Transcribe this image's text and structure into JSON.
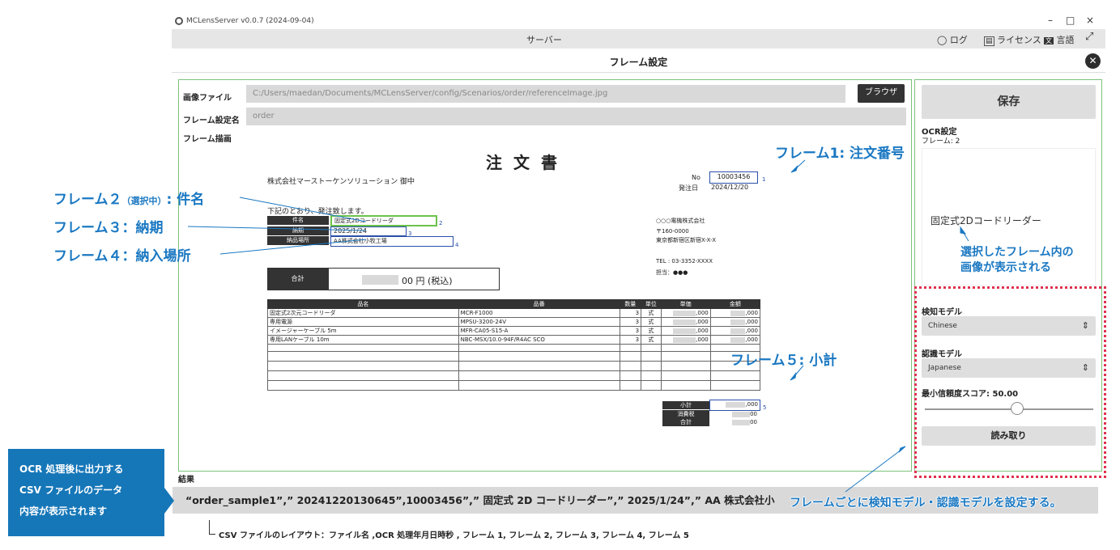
{
  "window": {
    "title": "MCLensServer v0.0.7 (2024-09-04)",
    "minimize": "–",
    "maximize": "□",
    "close": "×"
  },
  "topbar": {
    "title": "サーバー",
    "log_label": "ログ",
    "license_label": "ライセンス",
    "language_label": "言語"
  },
  "dialog": {
    "title": "フレーム設定"
  },
  "form": {
    "image_file_label": "画像ファイル",
    "image_file_value": "C:/Users/maedan/Documents/MCLensServer/config/Scenarios/order/referenceImage.jpg",
    "browse_label": "ブラウザ",
    "frame_name_label": "フレーム設定名",
    "frame_name_value": "order",
    "frame_draw_label": "フレーム描画",
    "result_label": "結果",
    "result_value": "“order_sample1”,” 20241220130645”,10003456”,” 固定式 2D コードリーダー”,” 2025/1/24”,” AA 株式会社小"
  },
  "document": {
    "title": "注文書",
    "addressee": "株式会社マーストーケンソリューション 御中",
    "no_label": "No",
    "no_value": "10003456",
    "issue_label": "発注日",
    "issue_date": "2024/12/20",
    "intro": "下記のとおり、発注致します。",
    "subject_label": "件名",
    "subject_value": "固定式2Dコードリーダ",
    "due_label": "納期",
    "due_value": "2025/1/24",
    "place_label": "納品場所",
    "place_value": "AA株式会社小牧工場",
    "total_label": "合計",
    "total_value": "00 円 (税込)",
    "company": "○○○電機株式会社",
    "zip": "〒160-0000",
    "address": "東京都新宿区新宿X-X-X",
    "tel": "TEL : 03-3352-XXXX",
    "person": "担当：●●●",
    "table_headers": [
      "品名",
      "品番",
      "数量",
      "単位",
      "単価",
      "金額"
    ],
    "rows": [
      [
        "固定式2次元コードリーダ",
        "MCR-F1000",
        "3",
        "式",
        ",000",
        ",000"
      ],
      [
        "専用電源",
        "MPSU-3200-24V",
        "3",
        "式",
        ",000",
        ",000"
      ],
      [
        "イメージャーケーブル 5m",
        "MFR-CA05-S15-A",
        "3",
        "式",
        ",000",
        ",000"
      ],
      [
        "専用LANケーブル 10m",
        "NBC-MSX/10.0-94F/R4AC SCO",
        "3",
        "式",
        ",000",
        ",000"
      ]
    ],
    "subtotal_label": "小計",
    "subtotal_value": ",000",
    "tax_label": "消費税",
    "tax_value": "00",
    "grand_label": "合計",
    "grand_value": "00",
    "frame_nums": [
      "1",
      "2",
      "3",
      "4",
      "5"
    ]
  },
  "right": {
    "save_label": "保存",
    "ocr_label": "OCR設定",
    "frame_label": "フレーム: 2",
    "preview_text": "固定式2Dコードリーダー",
    "detect_label": "検知モデル",
    "detect_value": "Chinese",
    "recog_label": "認識モデル",
    "recog_value": "Japanese",
    "score_label": "最小信頼度スコア: 50.00",
    "slider_fraction": 0.5,
    "read_label": "読み取り"
  },
  "annotations": {
    "frame1": "フレーム1: 注文番号",
    "frame2": "フレーム２",
    "frame2_sub": "（選択中）",
    "frame2_tail": ": 件名",
    "frame3": "フレーム３：納期",
    "frame4": "フレーム４：納入場所",
    "frame5": "フレーム５: 小計",
    "preview_note_1": "選択したフレーム内の",
    "preview_note_2": "画像が表示される",
    "model_note": "フレームごとに検知モデル・認識モデルを設定する。",
    "csv_note_1": "OCR 処理後に出力する",
    "csv_note_2": "CSV ファイルのデータ",
    "csv_note_3": "内容が表示されます",
    "layout_note": "CSV ファイルのレイアウト：ファイル名 ,OCR 処理年月日時秒 , フレーム 1, フレーム 2, フレーム 3, フレーム 4, フレーム 5"
  },
  "colors": {
    "accent_blue": "#1a78c2",
    "frame_green": "#7cc27c",
    "frame_blue": "#2a4fa8",
    "selected_frame": "#6cc24a",
    "dotted_red": "#e0304e"
  }
}
